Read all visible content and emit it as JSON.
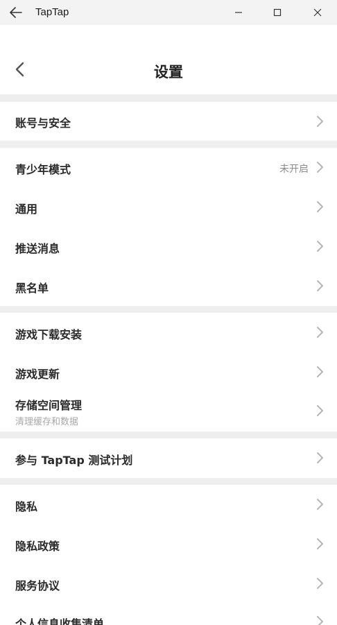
{
  "window": {
    "title": "TapTap",
    "back_icon": "arrow-left-icon",
    "minimize_icon": "minimize-icon",
    "maximize_icon": "maximize-icon",
    "close_icon": "close-icon"
  },
  "header": {
    "title": "设置",
    "back_icon": "chevron-left-icon"
  },
  "sections": [
    {
      "items": [
        {
          "label": "账号与安全"
        }
      ]
    },
    {
      "items": [
        {
          "label": "青少年模式",
          "value": "未开启"
        },
        {
          "label": "通用"
        },
        {
          "label": "推送消息"
        },
        {
          "label": "黑名单"
        }
      ]
    },
    {
      "items": [
        {
          "label": "游戏下载安装"
        },
        {
          "label": "游戏更新"
        },
        {
          "label": "存储空间管理",
          "sublabel": "清理缓存和数据"
        }
      ]
    },
    {
      "items": [
        {
          "label": "参与 TapTap 测试计划"
        }
      ]
    },
    {
      "items": [
        {
          "label": "隐私"
        },
        {
          "label": "隐私政策"
        },
        {
          "label": "服务协议"
        },
        {
          "label": "个人信息收集清单"
        }
      ]
    }
  ],
  "colors": {
    "separator": "#eeeeee",
    "chevron": "#b5b5b5",
    "label": "#2a2a2a",
    "muted": "#a8a8a8"
  }
}
